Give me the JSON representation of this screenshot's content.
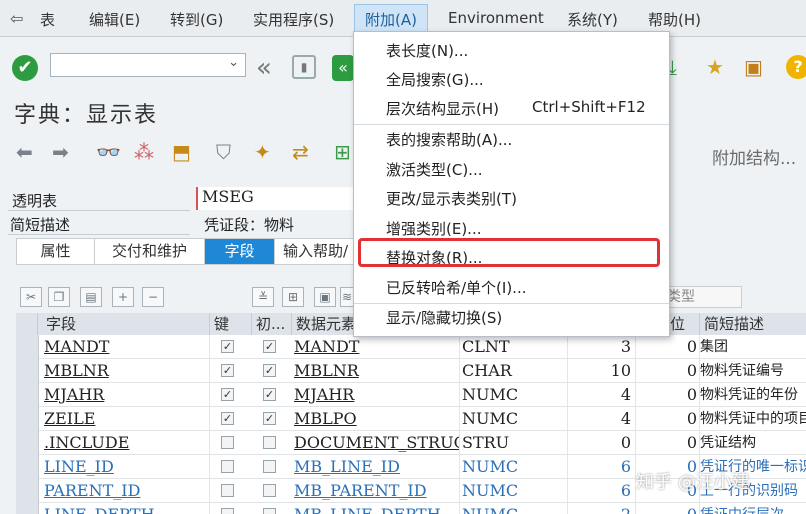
{
  "menubar": {
    "sap_icon": "sap-menu-icon",
    "items": [
      "表",
      "编辑(E)",
      "转到(G)",
      "实用程序(S)",
      "附加(A)",
      "Environment",
      "系统(Y)",
      "帮助(H)"
    ]
  },
  "toolbar": {
    "enter_check": "✔",
    "command_value": ""
  },
  "title": "字典：显示表",
  "app_toolbar": {
    "append_structure": "附加结构..."
  },
  "fields": {
    "transparent_table_label": "透明表",
    "transparent_table_value": "MSEG",
    "short_desc_label": "简短描述",
    "short_desc_value": "凭证段：物料"
  },
  "tabs": [
    "属性",
    "交付和维护",
    "字段",
    "输入帮助/"
  ],
  "type_field": "类型",
  "table": {
    "headers": [
      "字段",
      "键",
      "初...",
      "数据元素",
      "",
      "",
      "位",
      "简短描述"
    ],
    "rows": [
      {
        "field": "MANDT",
        "key": true,
        "init": true,
        "elem": "MANDT",
        "type": "CLNT",
        "len": "3",
        "dec": "0",
        "desc": "集团",
        "blue": false
      },
      {
        "field": "MBLNR",
        "key": true,
        "init": true,
        "elem": "MBLNR",
        "type": "CHAR",
        "len": "10",
        "dec": "0",
        "desc": "物料凭证编号",
        "blue": false
      },
      {
        "field": "MJAHR",
        "key": true,
        "init": true,
        "elem": "MJAHR",
        "type": "NUMC",
        "len": "4",
        "dec": "0",
        "desc": "物料凭证的年份",
        "blue": false
      },
      {
        "field": "ZEILE",
        "key": true,
        "init": true,
        "elem": "MBLPO",
        "type": "NUMC",
        "len": "4",
        "dec": "0",
        "desc": "物料凭证中的项目",
        "blue": false
      },
      {
        "field": ".INCLUDE",
        "key": false,
        "init": false,
        "elem": "DOCUMENT_STRUCTU",
        "type": "STRU",
        "len": "0",
        "dec": "0",
        "desc": "凭证结构",
        "blue": false
      },
      {
        "field": "LINE_ID",
        "key": false,
        "init": false,
        "elem": "MB_LINE_ID",
        "type": "NUMC",
        "len": "6",
        "dec": "0",
        "desc": "凭证行的唯一标识",
        "blue": true
      },
      {
        "field": "PARENT_ID",
        "key": false,
        "init": false,
        "elem": "MB_PARENT_ID",
        "type": "NUMC",
        "len": "6",
        "dec": "0",
        "desc": "上一行的识别码",
        "blue": true
      },
      {
        "field": "LINE_DEPTH",
        "key": false,
        "init": false,
        "elem": "MB_LINE_DEPTH",
        "type": "NUMC",
        "len": "2",
        "dec": "0",
        "desc": "凭证中行层次",
        "blue": true
      }
    ]
  },
  "dropdown": {
    "items": [
      "表长度(N)...",
      "全局搜索(G)...",
      "层次结构显示(H)",
      "表的搜索帮助(A)...",
      "激活类型(C)...",
      "更改/显示表类别(T)",
      "增强类别(E)...",
      "替换对象(R)...",
      "已反转哈希/单个(I)...",
      "显示/隐藏切换(S)"
    ],
    "shortcut": "Ctrl+Shift+F12"
  },
  "watermark": "知乎 @汪小建",
  "colors": {
    "accent": "#1e88d6",
    "highlight_box": "#e03232",
    "ok_green": "#2d9b3f"
  }
}
